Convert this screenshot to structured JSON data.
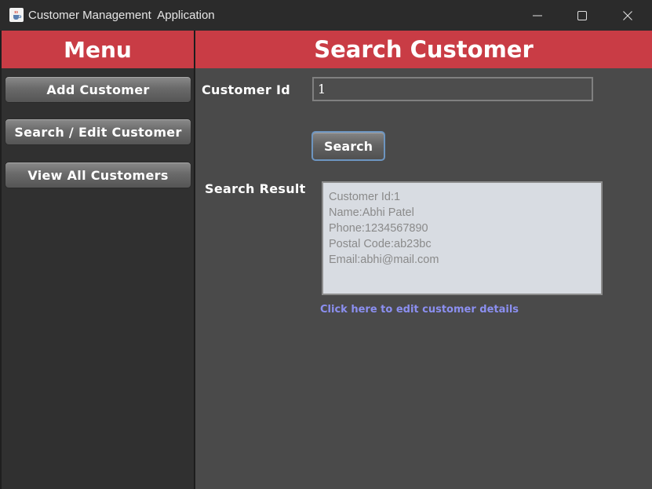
{
  "window": {
    "title": "Customer Management  Application",
    "icons": {
      "app": "java-cup-icon",
      "minimize": "minimize-icon",
      "maximize": "maximize-icon",
      "close": "close-icon"
    }
  },
  "menu": {
    "header": "Menu",
    "items": [
      {
        "label": "Add Customer"
      },
      {
        "label": "Search / Edit Customer"
      },
      {
        "label": "View All Customers"
      }
    ]
  },
  "main": {
    "header": "Search Customer",
    "customer_id_label": "Customer Id",
    "customer_id_value": "1",
    "search_button": "Search",
    "result_label": "Search Result",
    "result_lines": [
      "Customer Id:1",
      "Name:Abhi Patel",
      "Phone:1234567890",
      "Postal Code:ab23bc",
      "Email:abhi@mail.com"
    ],
    "edit_link": "Click here to edit customer details"
  },
  "colors": {
    "header_red": "#c93c45",
    "menu_bg": "#303030",
    "main_bg": "#4a4a4a",
    "titlebar_bg": "#2b2b2b",
    "link": "#8b8ff0"
  }
}
